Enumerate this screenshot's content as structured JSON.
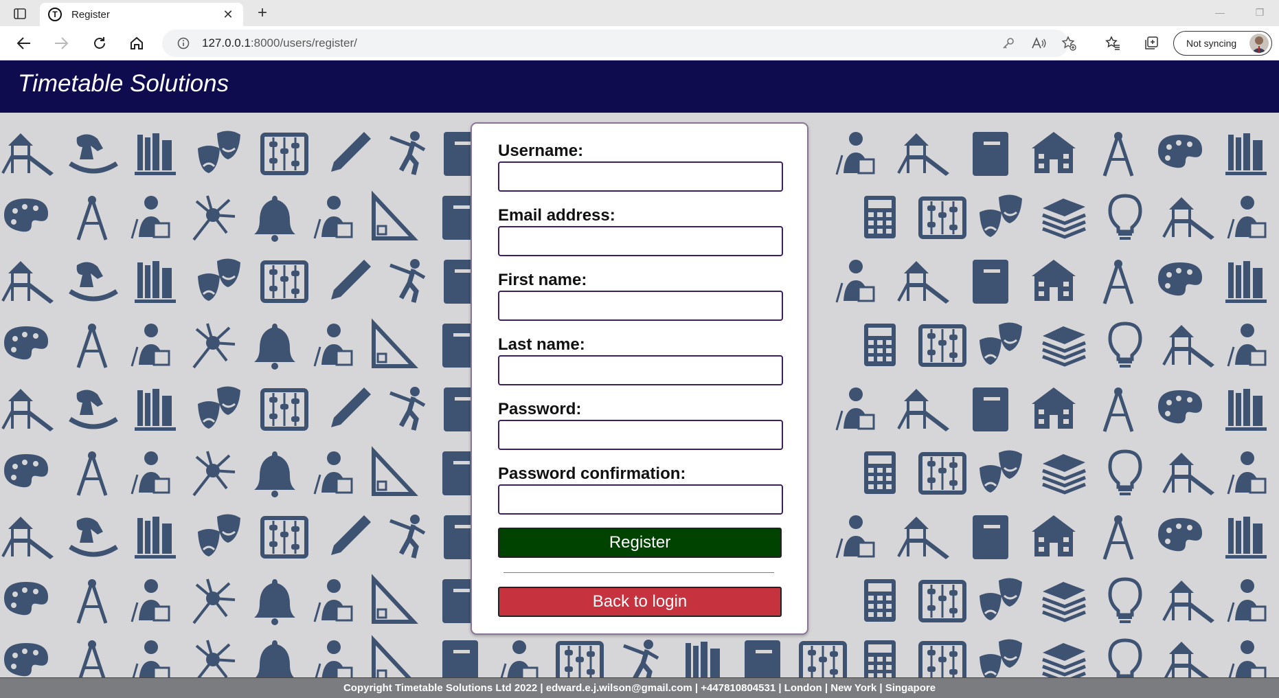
{
  "browser": {
    "tab_title": "Register",
    "favicon_letter": "T",
    "url_host": "127.0.0.1",
    "url_path": ":8000/users/register/",
    "sync_label": "Not syncing"
  },
  "header": {
    "site_title": "Timetable Solutions"
  },
  "form": {
    "fields": [
      {
        "label": "Username:",
        "value": ""
      },
      {
        "label": "Email address:",
        "value": ""
      },
      {
        "label": "First name:",
        "value": ""
      },
      {
        "label": "Last name:",
        "value": ""
      },
      {
        "label": "Password:",
        "value": ""
      },
      {
        "label": "Password confirmation:",
        "value": ""
      }
    ],
    "register_label": "Register",
    "back_label": "Back to login"
  },
  "footer": {
    "text": "Copyright Timetable Solutions Ltd 2022 | edward.e.j.wilson@gmail.com | +447810804531 | London | New York | Singapore"
  },
  "colors": {
    "header_bg": "#0e0b4f",
    "register_bg": "#004200",
    "back_bg": "#c7323f",
    "pattern_icon": "#3e5272",
    "pattern_bg": "#d6d6d8"
  },
  "background_icons": [
    "playground-icon",
    "rocking-horse-icon",
    "books-icon",
    "theatre-masks-icon",
    "abacus-icon",
    "pencil-icon",
    "cricket-player-icon",
    "teacher-icon",
    "palette-icon",
    "compass-icon",
    "neuron-icon",
    "bell-icon",
    "set-square-icon",
    "notebook-icon",
    "calculator-icon",
    "lightbulb-icon",
    "school-icon",
    "football-icon",
    "music-note-icon",
    "piano-icon",
    "xylophone-icon"
  ]
}
